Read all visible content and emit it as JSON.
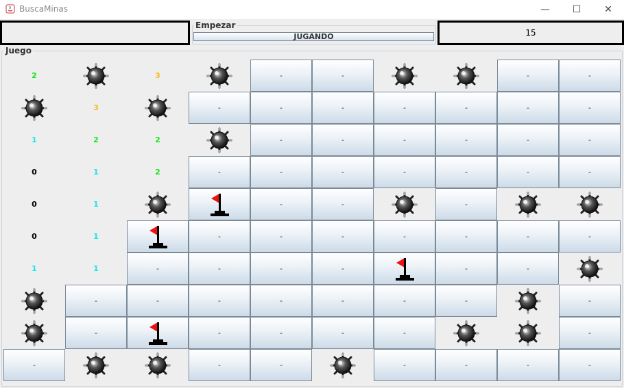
{
  "window": {
    "title": "BuscaMinas",
    "minimize": "—",
    "maximize": "☐",
    "close": "✕"
  },
  "toolbar": {
    "left_counter": "",
    "start_legend": "Empezar",
    "status_button": "JUGANDO",
    "right_counter": "15"
  },
  "game": {
    "legend": "Juego",
    "board": [
      [
        "2",
        "M",
        "3",
        "M",
        "-",
        "-",
        "M",
        "M",
        "-",
        "-"
      ],
      [
        "M",
        "3",
        "M",
        "-",
        "-",
        "-",
        "-",
        "-",
        "-",
        "-"
      ],
      [
        "1",
        "2",
        "2",
        "M",
        "-",
        "-",
        "-",
        "-",
        "-",
        "-"
      ],
      [
        "0",
        "1",
        "2",
        "-",
        "-",
        "-",
        "-",
        "-",
        "-",
        "-"
      ],
      [
        "0",
        "1",
        "M",
        "F",
        "-",
        "-",
        "M",
        "-",
        "M",
        "M"
      ],
      [
        "0",
        "1",
        "F",
        "-",
        "-",
        "-",
        "-",
        "-",
        "-",
        "-"
      ],
      [
        "1",
        "1",
        "-",
        "-",
        "-",
        "-",
        "F",
        "-",
        "-",
        "M"
      ],
      [
        "M",
        "-",
        "-",
        "-",
        "-",
        "-",
        "-",
        "-",
        "M",
        "-"
      ],
      [
        "M",
        "-",
        "F",
        "-",
        "-",
        "-",
        "-",
        "M",
        "M",
        "-"
      ],
      [
        "-",
        "M",
        "M",
        "-",
        "-",
        "M",
        "-",
        "-",
        "-",
        "-"
      ]
    ]
  },
  "icons": {
    "mine": "mine-icon",
    "flag": "flag-icon"
  },
  "colors": {
    "num0": "#000000",
    "num1": "#1ee6e6",
    "num2": "#17e617",
    "num3": "#f4bb1c",
    "flag": "#ee1111"
  }
}
